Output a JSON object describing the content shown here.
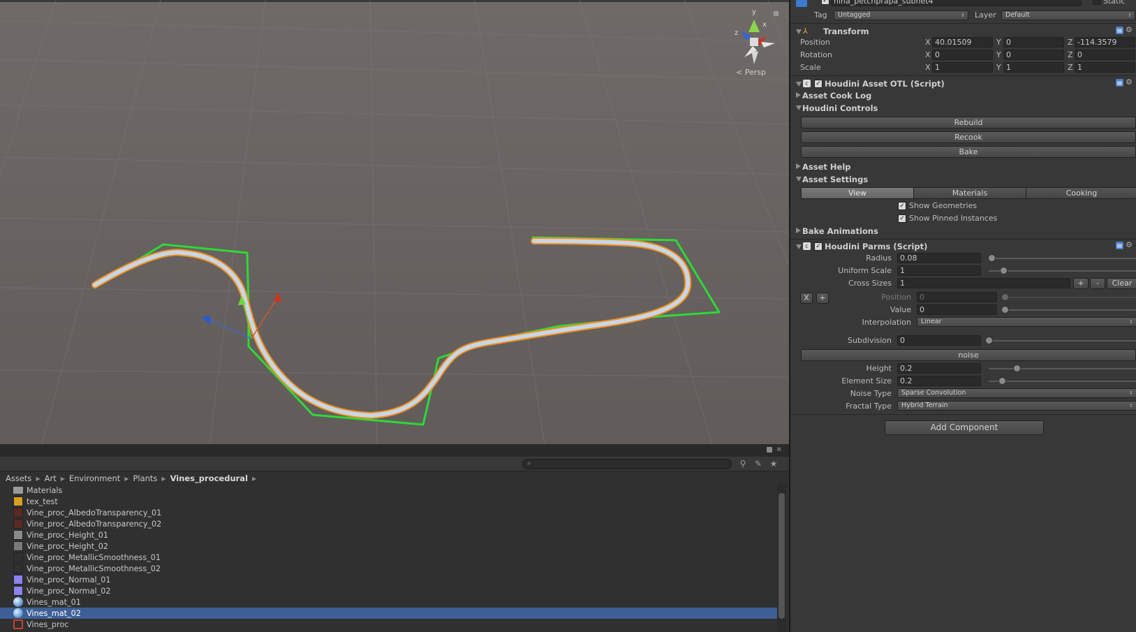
{
  "viewport": {
    "persp_label": "Persp",
    "gizmo_axes": {
      "y": "y",
      "x": "x",
      "z": "z"
    }
  },
  "inspector": {
    "object_name": "nina_petchprapa_subnet4",
    "static_label": "Static",
    "tag_label": "Tag",
    "tag_value": "Untagged",
    "layer_label": "Layer",
    "layer_value": "Default",
    "transform": {
      "title": "Transform",
      "position_label": "Position",
      "rotation_label": "Rotation",
      "scale_label": "Scale",
      "position": {
        "x": "40.01509",
        "y": "0",
        "z": "-114.3579"
      },
      "rotation": {
        "x": "0",
        "y": "0",
        "z": "0"
      },
      "scale": {
        "x": "1",
        "y": "1",
        "z": "1"
      },
      "axis_x": "X",
      "axis_y": "Y",
      "axis_z": "Z"
    },
    "houdini_asset": {
      "title": "Houdini Asset OTL (Script)",
      "cook_log": "Asset Cook Log",
      "controls": "Houdini Controls",
      "rebuild": "Rebuild",
      "recook": "Recook",
      "bake": "Bake",
      "help": "Asset Help",
      "settings": "Asset Settings",
      "tabs": [
        "View",
        "Materials",
        "Cooking"
      ],
      "show_geometries": "Show Geometries",
      "show_pinned": "Show Pinned Instances",
      "bake_animations": "Bake Animations"
    },
    "houdini_parms": {
      "title": "Houdini Parms (Script)",
      "radius_label": "Radius",
      "radius_value": "0.08",
      "radius_level": 0.02,
      "uniform_scale_label": "Uniform Scale",
      "uniform_scale_value": "1",
      "uniform_scale_level": 0.1,
      "cross_sizes_label": "Cross Sizes",
      "cross_sizes_value": "1",
      "plus": "+",
      "minus": "-",
      "clear": "Clear",
      "x_btn": "X",
      "add_btn": "+",
      "position_label": "Position",
      "position_value": "0",
      "value_label": "Value",
      "value_value": "0",
      "interpolation_label": "Interpolation",
      "interpolation_value": "Linear",
      "subdivision_label": "Subdivision",
      "subdivision_value": "0",
      "noise_header": "noise",
      "height_label": "Height",
      "height_value": "0.2",
      "element_size_label": "Element Size",
      "element_size_value": "0.2",
      "noise_type_label": "Noise Type",
      "noise_type_value": "Sparse Convolution",
      "fractal_type_label": "Fractal Type",
      "fractal_type_value": "Hybrid Terrain"
    },
    "add_component": "Add Component"
  },
  "project": {
    "breadcrumb": [
      "Assets",
      "Art",
      "Environment",
      "Plants",
      "Vines_procedural"
    ],
    "files": [
      {
        "name": "Materials",
        "icon": "folder-icon",
        "color": "#9a9a9a"
      },
      {
        "name": "tex_test",
        "icon": "texture-icon",
        "color": "#d8a020"
      },
      {
        "name": "Vine_proc_AlbedoTransparency_01",
        "icon": "texture-icon",
        "color": "#5a2a22"
      },
      {
        "name": "Vine_proc_AlbedoTransparency_02",
        "icon": "texture-icon",
        "color": "#5a2a22"
      },
      {
        "name": "Vine_proc_Height_01",
        "icon": "texture-icon",
        "color": "#8a8a8a"
      },
      {
        "name": "Vine_proc_Height_02",
        "icon": "texture-icon",
        "color": "#7a7a7a"
      },
      {
        "name": "Vine_proc_MetallicSmoothness_01",
        "icon": "texture-icon",
        "color": "#303030"
      },
      {
        "name": "Vine_proc_MetallicSmoothness_02",
        "icon": "texture-icon",
        "color": "#303030"
      },
      {
        "name": "Vine_proc_Normal_01",
        "icon": "texture-icon",
        "color": "#8c82f0"
      },
      {
        "name": "Vine_proc_Normal_02",
        "icon": "texture-icon",
        "color": "#8c82f0"
      },
      {
        "name": "Vines_mat_01",
        "icon": "material-icon",
        "color": "#6aa0d8"
      },
      {
        "name": "Vines_mat_02",
        "icon": "material-icon",
        "color": "#6aa0d8"
      },
      {
        "name": "Vines_proc",
        "icon": "prefab-icon",
        "color": "#c84028"
      }
    ],
    "selected_index": 11
  }
}
